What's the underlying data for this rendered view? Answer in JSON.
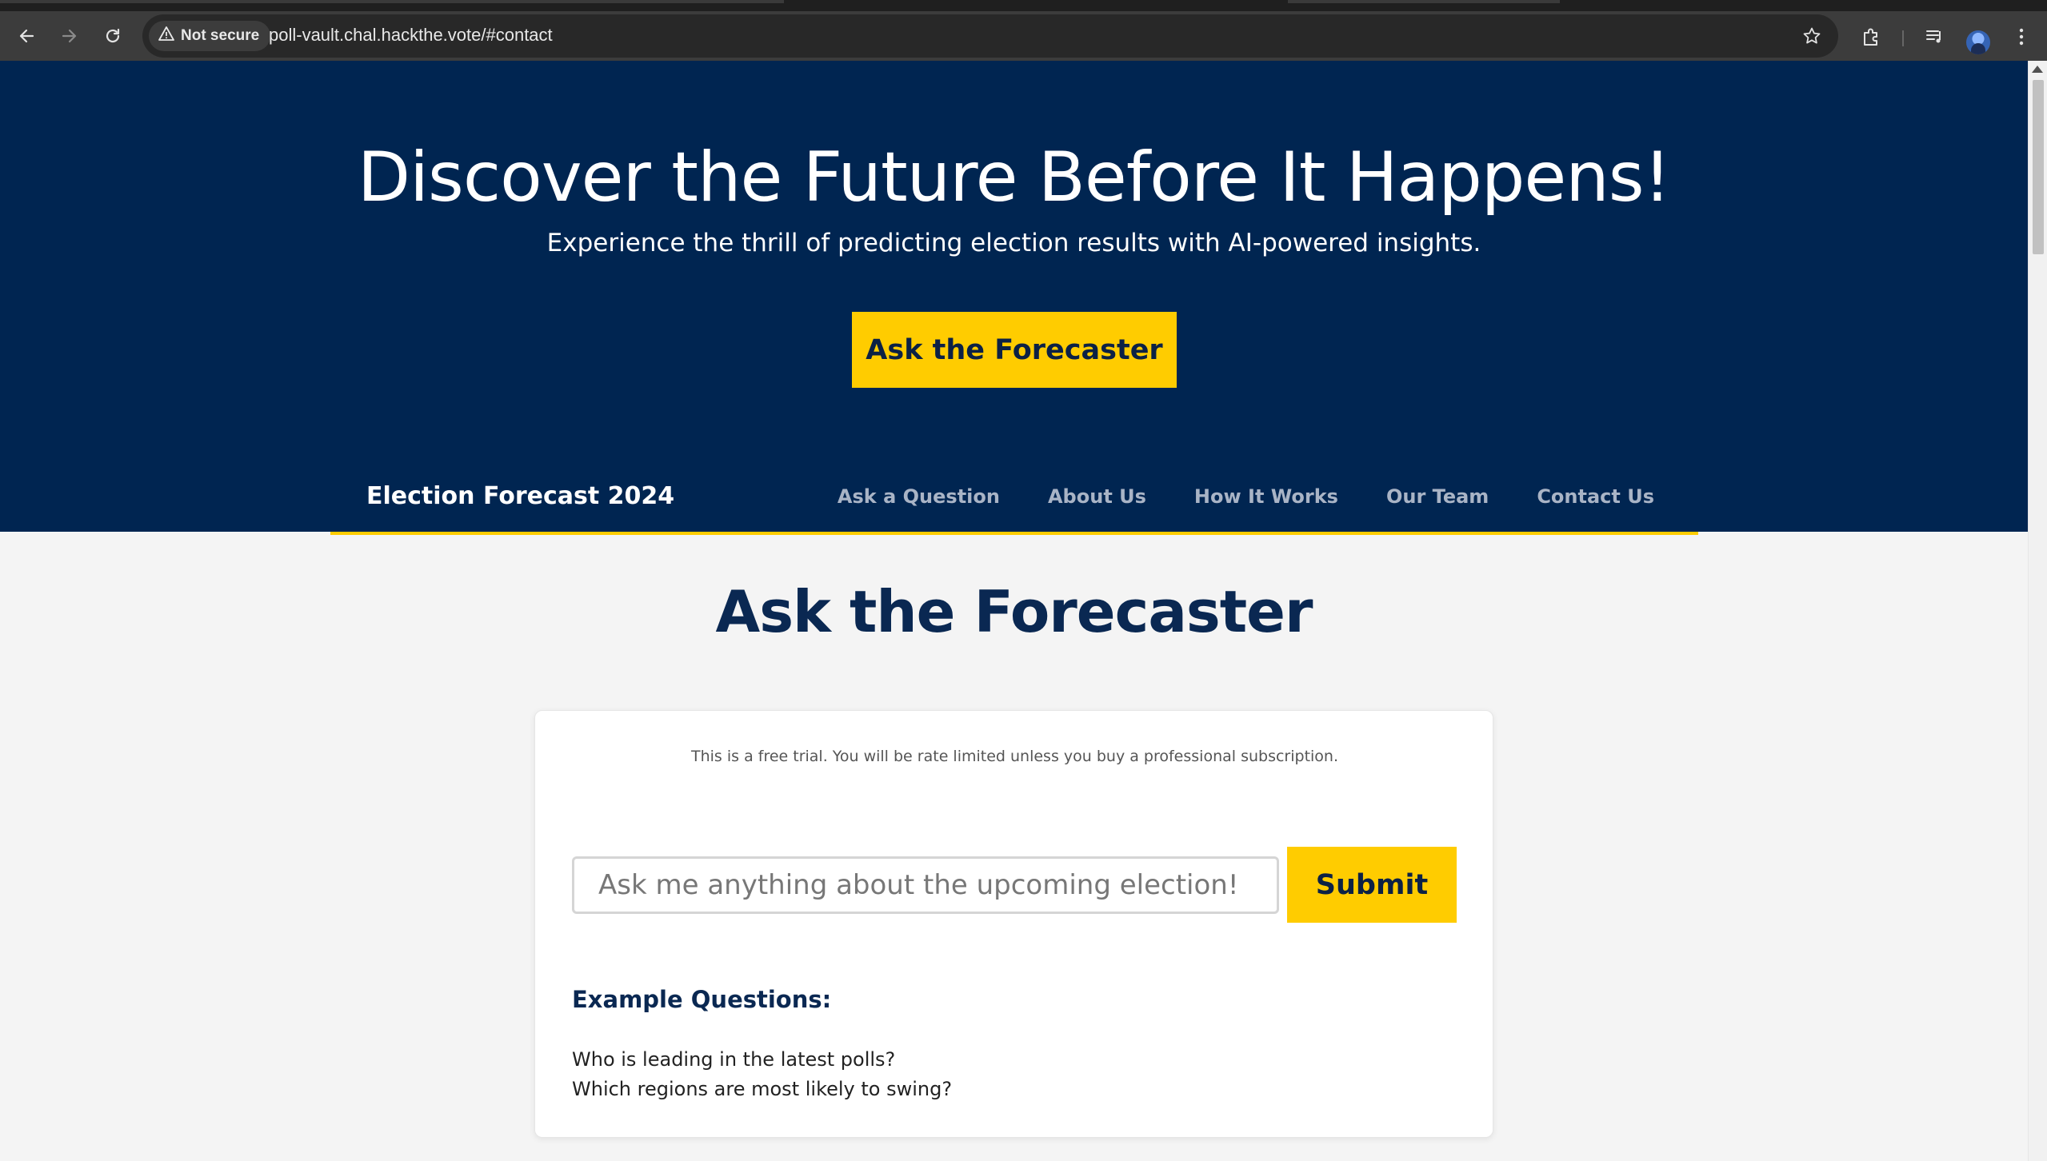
{
  "browser": {
    "security_label": "Not secure",
    "url": "poll-vault.chal.hackthe.vote/#contact",
    "icons": [
      "back-icon",
      "forward-icon",
      "reload-icon",
      "warning-icon",
      "star-icon",
      "extensions-icon",
      "media-queue-icon",
      "profile-avatar",
      "more-menu-icon"
    ]
  },
  "hero": {
    "title": "Discover the Future Before It Happens!",
    "subtitle": "Experience the thrill of predicting election results with AI-powered insights.",
    "cta_label": "Ask the Forecaster"
  },
  "navbar": {
    "brand": "Election Forecast 2024",
    "links": [
      {
        "label": "Ask a Question"
      },
      {
        "label": "About Us"
      },
      {
        "label": "How It Works"
      },
      {
        "label": "Our Team"
      },
      {
        "label": "Contact Us"
      }
    ]
  },
  "section": {
    "title": "Ask the Forecaster"
  },
  "card": {
    "trial_note": "This is a free trial. You will be rate limited unless you buy a professional subscription.",
    "input_placeholder": "Ask me anything about the upcoming election!",
    "input_value": "",
    "submit_label": "Submit",
    "examples_title": "Example Questions:",
    "examples": [
      "Who is leading in the latest polls?",
      "Which regions are most likely to swing?"
    ]
  },
  "colors": {
    "hero_bg": "#002551",
    "accent": "#ffcc00",
    "heading": "#0a2852",
    "page_bg": "#f4f4f4"
  }
}
